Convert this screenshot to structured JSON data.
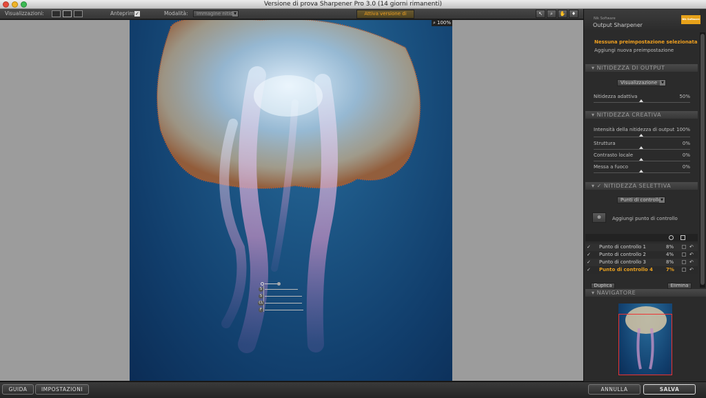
{
  "window": {
    "title": "Versione di prova Sharpener Pro 3.0 (14 giorni rimanenti)"
  },
  "toolbar": {
    "views_label": "Visualizzazioni:",
    "preview_label": "Anteprima:",
    "preview_checked": "✓",
    "mode_label": "Modalità:",
    "mode_value": "Immagine nitida",
    "activate_label": "Attiva versione di prova",
    "tools": [
      "arrow-icon",
      "zoom-icon",
      "hand-icon",
      "pin-icon"
    ]
  },
  "canvas": {
    "zoom": "100%"
  },
  "panel": {
    "brand_small": "Nik Software",
    "brand_title": "Output Sharpener",
    "logo_text": "Nik Software",
    "preset_selected": "Nessuna preimpostazione selezionata",
    "preset_add": "Aggiungi nuova preimpostazione",
    "output": {
      "title": "NITIDEZZA DI OUTPUT",
      "dropdown": "Visualizzazione",
      "adaptive_label": "Nitidezza adattiva",
      "adaptive_value": "50%"
    },
    "creative": {
      "title": "NITIDEZZA CREATIVA",
      "items": [
        {
          "label": "Intensità della nitidezza di output",
          "value": "100%"
        },
        {
          "label": "Struttura",
          "value": "0%"
        },
        {
          "label": "Contrasto locale",
          "value": "0%"
        },
        {
          "label": "Messa a fuoco",
          "value": "0%"
        }
      ]
    },
    "selective": {
      "title": "NITIDEZZA SELETTIVA",
      "check": "✓",
      "dropdown": "Punti di controllo",
      "add_label": "Aggiungi punto di controllo",
      "points": [
        {
          "name": "Punto di controllo 1",
          "value": "8%"
        },
        {
          "name": "Punto di controllo 2",
          "value": "4%"
        },
        {
          "name": "Punto di controllo 3",
          "value": "8%"
        },
        {
          "name": "Punto di controllo 4",
          "value": "7%"
        }
      ],
      "duplicate": "Duplica",
      "delete": "Elimina"
    },
    "navigator": {
      "title": "NAVIGATORE"
    }
  },
  "bottom": {
    "help": "GUIDA",
    "settings": "IMPOSTAZIONI",
    "cancel": "ANNULLA",
    "save": "SALVA"
  },
  "control_point_letters": [
    "S",
    "S",
    "CL",
    "F"
  ],
  "colors": {
    "accent": "#f0a020",
    "selected_row": "#e8a020",
    "panel_bg": "#2b2b2b"
  }
}
